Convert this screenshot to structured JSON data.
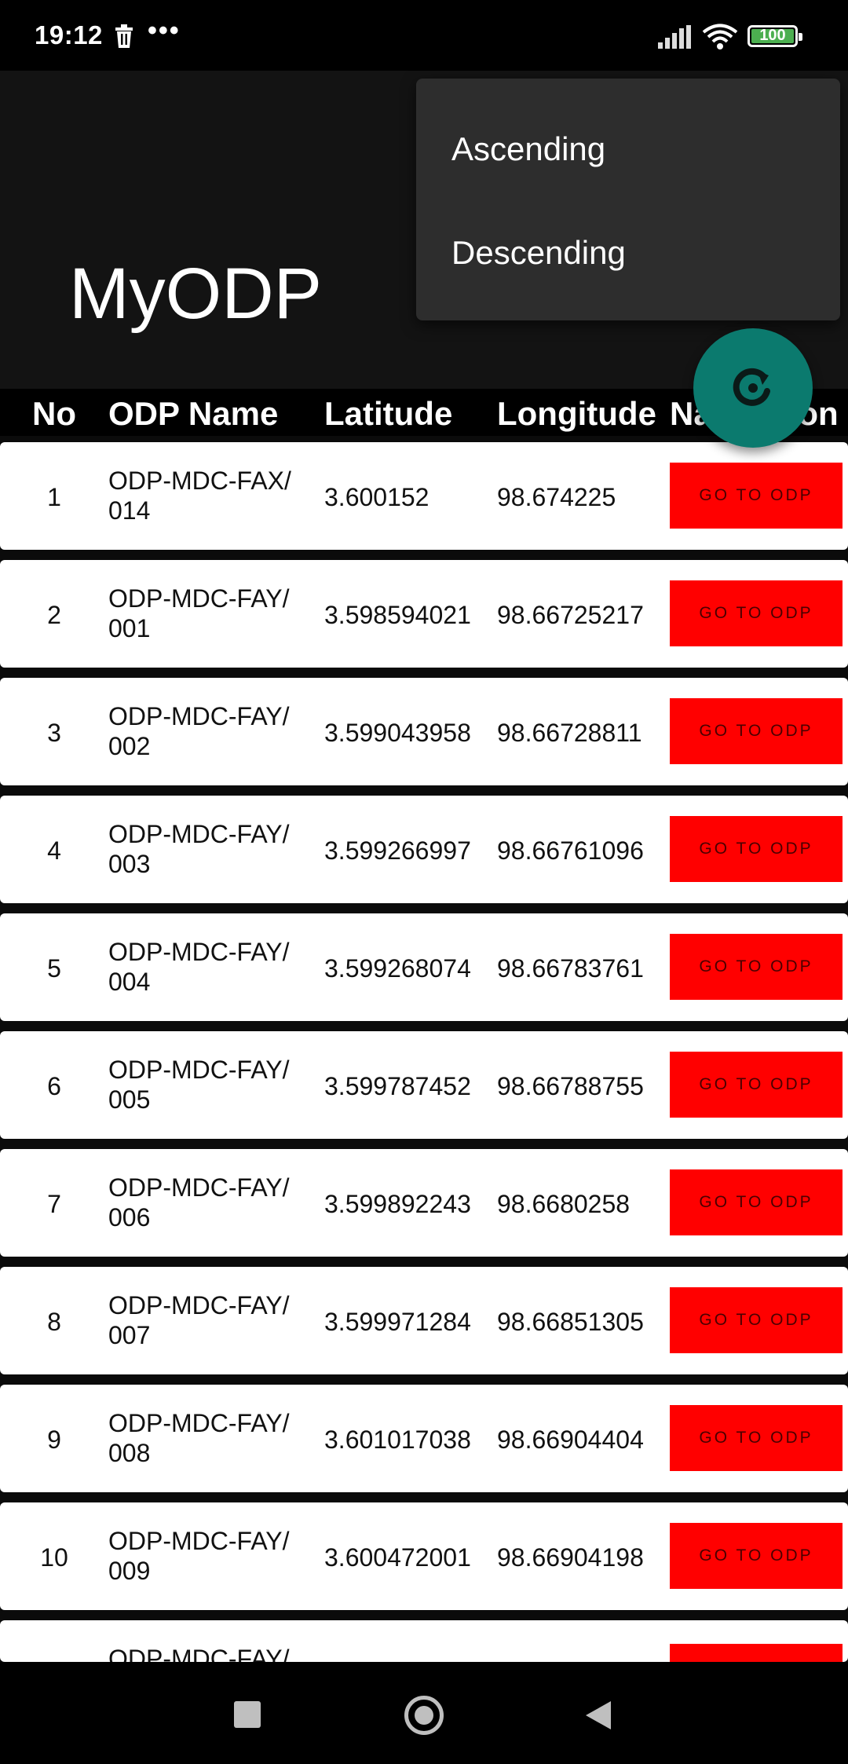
{
  "status_bar": {
    "time": "19:12",
    "dots": "•••",
    "battery": "100"
  },
  "app": {
    "title": "MyODP"
  },
  "menu": {
    "items": [
      "Ascending",
      "Descending"
    ]
  },
  "table": {
    "headers": {
      "no": "No",
      "name": "ODP Name",
      "lat": "Latitude",
      "lng": "Longitude",
      "nav": "Navigation"
    },
    "button_label": "GO TO ODP",
    "rows": [
      {
        "no": "1",
        "name_line1": "ODP-MDC-FAX/",
        "name_line2": "014",
        "lat": "3.600152",
        "lng": "98.674225"
      },
      {
        "no": "2",
        "name_line1": "ODP-MDC-FAY/",
        "name_line2": "001",
        "lat": "3.598594021",
        "lng": "98.66725217"
      },
      {
        "no": "3",
        "name_line1": "ODP-MDC-FAY/",
        "name_line2": "002",
        "lat": "3.599043958",
        "lng": "98.66728811"
      },
      {
        "no": "4",
        "name_line1": "ODP-MDC-FAY/",
        "name_line2": "003",
        "lat": "3.599266997",
        "lng": "98.66761096"
      },
      {
        "no": "5",
        "name_line1": "ODP-MDC-FAY/",
        "name_line2": "004",
        "lat": "3.599268074",
        "lng": "98.66783761"
      },
      {
        "no": "6",
        "name_line1": "ODP-MDC-FAY/",
        "name_line2": "005",
        "lat": "3.599787452",
        "lng": "98.66788755"
      },
      {
        "no": "7",
        "name_line1": "ODP-MDC-FAY/",
        "name_line2": "006",
        "lat": "3.599892243",
        "lng": "98.6680258"
      },
      {
        "no": "8",
        "name_line1": "ODP-MDC-FAY/",
        "name_line2": "007",
        "lat": "3.599971284",
        "lng": "98.66851305"
      },
      {
        "no": "9",
        "name_line1": "ODP-MDC-FAY/",
        "name_line2": "008",
        "lat": "3.601017038",
        "lng": "98.66904404"
      },
      {
        "no": "10",
        "name_line1": "ODP-MDC-FAY/",
        "name_line2": "009",
        "lat": "3.600472001",
        "lng": "98.66904198"
      },
      {
        "no": "",
        "name_line1": "ODP-MDC-FAY/",
        "name_line2": "",
        "lat": "",
        "lng": ""
      }
    ]
  },
  "colors": {
    "accent_fab": "#0b7a6e",
    "button_red": "#ff0000",
    "header_bg": "#131313"
  },
  "icons": {
    "refresh": "refresh-icon",
    "trash": "trash-icon",
    "signal": "signal-icon",
    "wifi": "wifi-icon",
    "battery": "battery-icon"
  }
}
